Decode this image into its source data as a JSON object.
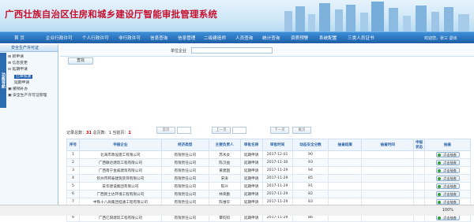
{
  "header": {
    "title": "广西壮族自治区住房和城乡建设厅智能审批管理系统"
  },
  "nav": {
    "items": [
      "首  页",
      "企业行政许可",
      "个人行政许可",
      "非行政许可",
      "信息查询",
      "信息管理",
      "二级建造师",
      "人员查询",
      "统计查询",
      "资质预警",
      "系统配置",
      "三类人员证书"
    ],
    "welcome": "欢迎您，张三 退出"
  },
  "sidebar": {
    "panel_title": "安全生产许可证",
    "vertical_label": "功能导航",
    "tree": [
      "新申请",
      "信息变更",
      "延期申请",
      "已审核通",
      "延期申请",
      "撤销补办",
      "安全生产许可证管理"
    ]
  },
  "search": {
    "label": "单位企业",
    "value": "",
    "query_button": "查找"
  },
  "pager": {
    "total_label": "记录总数：",
    "total": "31",
    "pages_label": "总页数：",
    "pages": "1",
    "current_label": "当前页：",
    "current": "1",
    "buttons": [
      "首页",
      "上一页",
      "下一页",
      "尾页"
    ]
  },
  "table": {
    "headers": [
      "序号",
      "申报企业",
      "经济类型",
      "主要负责人",
      "审批名称",
      "审批时间",
      "动态安全分数",
      "抽查结果",
      "抽查时间",
      "申报状态",
      "抽查"
    ],
    "rows": [
      [
        "1",
        "北海市政设建工有限公司",
        "有限责任公司",
        "苏木女",
        "延期申请",
        "2017-12-01",
        "90",
        "",
        "",
        "",
        "点击抽查"
      ],
      [
        "2",
        "广西联达建筑工程有限公司",
        "有限责任公司",
        "陈汉益",
        "延期申请",
        "2017-11-30",
        "93",
        "",
        "",
        "",
        "点击抽查"
      ],
      [
        "3",
        "广西南宁金威建筑有限公司",
        "有限责任公司",
        "黄建国",
        "延期申请",
        "2017-11-29",
        "94",
        "",
        "",
        "",
        "点击抽查"
      ],
      [
        "4",
        "钦州市邦泰建筑装饰有限公司",
        "有限责任公司",
        "宋涛",
        "延期申请",
        "2017-11-29",
        "85",
        "",
        "",
        "",
        "点击抽查"
      ],
      [
        "5",
        "安华建设集团有限公司",
        "有限责任公司",
        "陈兴",
        "延期申请",
        "2017-11-29",
        "91",
        "",
        "",
        "",
        "点击抽查"
      ],
      [
        "6",
        "广西民士达环境工程有限公司",
        "有限责任公司",
        "林英勤",
        "延期申请",
        "2017-11-29",
        "82",
        "",
        "",
        "",
        "点击抽查"
      ],
      [
        "7",
        "中铁十八局集团桂通工程有限公司",
        "有限责任公司",
        "陈维华",
        "延期申请",
        "2017-11-29",
        "83",
        "",
        "",
        "",
        "点击抽查"
      ],
      [
        "8",
        "广西中泰建筑设备租赁有限公司",
        "有限责任公司",
        "黄少全",
        "延期申请",
        "2017-11-29",
        "92",
        "",
        "",
        "",
        "点击抽查"
      ],
      [
        "9",
        "广西亿阳建筑工程有限公司",
        "有限责任公司",
        "覃钧钧",
        "延期申请",
        "2017-11-29",
        "86",
        "",
        "",
        "",
        "点击抽查"
      ]
    ]
  },
  "statusbar": {
    "zoom": "100%"
  }
}
